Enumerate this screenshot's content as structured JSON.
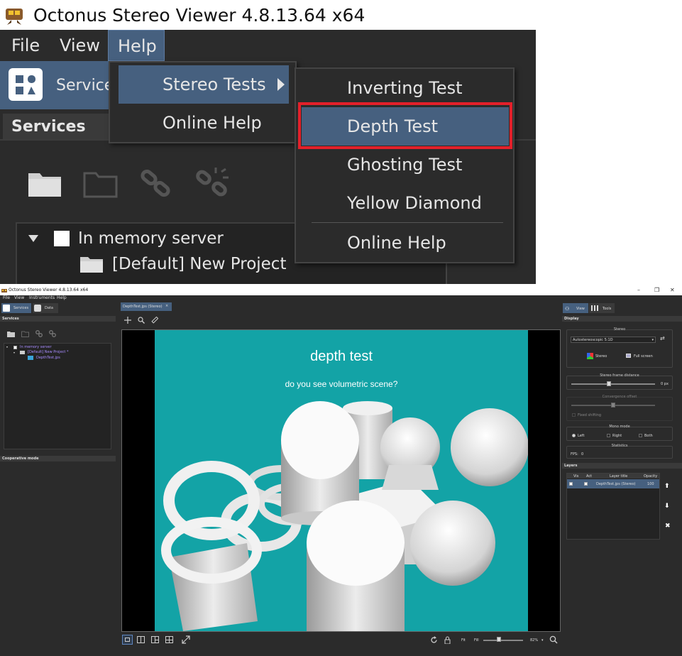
{
  "zoom": {
    "window_title": "Octonus Stereo Viewer 4.8.13.64 x64",
    "menu": [
      "File",
      "View",
      "Help"
    ],
    "services_tab_label": "Service",
    "panel_title": "Services",
    "tree": {
      "server": "In memory server",
      "project": "[Default] New Project"
    },
    "help_menu": {
      "items": [
        "Stereo Tests",
        "Online Help"
      ]
    },
    "stereo_tests_menu": {
      "items": [
        "Inverting Test",
        "Depth Test",
        "Ghosting Test",
        "Yellow Diamond",
        "Online Help"
      ],
      "highlighted": "Depth Test"
    }
  },
  "app": {
    "window_title": "Octonus Stereo Viewer 4.8.13.64 x64",
    "window_controls": [
      "–",
      "❐",
      "✕"
    ],
    "menu": [
      "File",
      "View",
      "Instruments",
      "Help"
    ],
    "left_tabs": [
      "Services",
      "Data"
    ],
    "services_header": "Services",
    "tree": {
      "server": "In memory server",
      "project": "[Default] New Project *",
      "file": "DepthTest.jps"
    },
    "cooperative_header": "Cooperative mode",
    "doc_tab": "DepthTest.jps (Stereo)",
    "doc_tab_close": "×",
    "image": {
      "heading": "depth test",
      "question": "do you see volumetric scene?",
      "bg_color": "#13a3a6"
    },
    "bottom_bar": {
      "fit": "Fit",
      "fill": "Fill",
      "zoom": "82%",
      "zoom_level": 0.4
    },
    "right_tabs": [
      "View",
      "Tools"
    ],
    "display_header": "Display",
    "stereo": {
      "group_title": "Stereo",
      "mode": "Autostereoscopic 5:1D",
      "stereo_button": "Stereo",
      "fullscreen_button": "Full screen"
    },
    "frame_distance": {
      "group_title": "Stereo frame distance",
      "value": "0 px",
      "level": 0.45
    },
    "convergence": {
      "group_title": "Convergence offset",
      "checkbox": "Fixed shifting",
      "level": 0.5
    },
    "mono_mode": {
      "group_title": "Mono mode",
      "options": [
        "Left",
        "Right",
        "Both"
      ],
      "selected": "Left"
    },
    "statistics": {
      "group_title": "Statistics",
      "fps_label": "FPS:",
      "fps_value": "0"
    },
    "layers": {
      "header": "Layers",
      "columns": [
        "Vis",
        "Act",
        "Layer title",
        "Opacity"
      ],
      "rows": [
        {
          "title": "DepthTest.jps (Stereo)",
          "opacity": "100"
        }
      ]
    }
  }
}
